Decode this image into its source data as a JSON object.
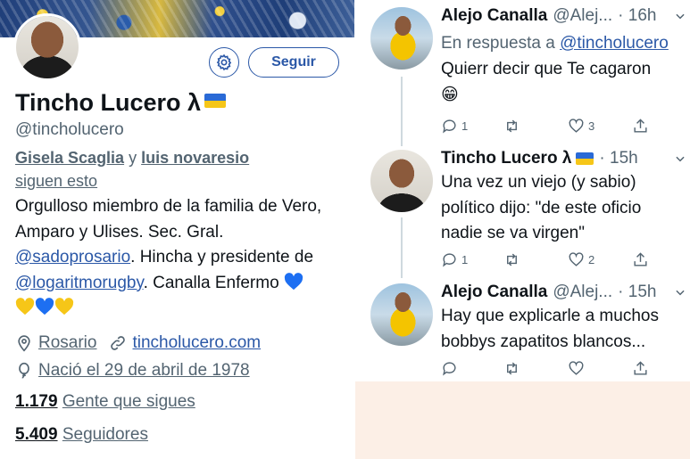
{
  "profile": {
    "name": "Tincho Lucero λ",
    "handle": "@tincholucero",
    "follow_label": "Seguir",
    "followed_by": {
      "user1": "Gisela Scaglia",
      "connector": "y",
      "user2": "luis novaresio",
      "suffix": "siguen esto"
    },
    "bio": {
      "part1": "Orgulloso miembro de la familia de Vero, Amparo y Ulises. Sec. Gral. ",
      "link1": "@sadoprosario",
      "part2": ". Hincha y presidente de ",
      "link2": "@logaritmorugby",
      "part3": ". Canalla Enfermo "
    },
    "location": "Rosario",
    "website": "tincholucero.com",
    "birth": "Nació el 29 de abril de 1978",
    "following_count": "1.179",
    "following_label": "Gente que sigues",
    "followers_count": "5.409",
    "followers_label": "Seguidores"
  },
  "colors": {
    "accent": "#2b58a7",
    "muted": "#536471",
    "heart_blue": "#1d6ff2",
    "heart_yellow": "#f6c618"
  },
  "tweets": [
    {
      "name": "Alejo Canalla",
      "handle": "@Alej...",
      "time": "· 16h",
      "reply_prefix": "En respuesta a",
      "reply_to": "@tincholucero",
      "text": "Quierr decir que Te cagaron",
      "emoji": "😁",
      "replies": "1",
      "likes": "3"
    },
    {
      "name": "Tincho Lucero λ",
      "handle": "",
      "time": "· 15h",
      "text": "Una vez un viejo (y sabio) político dijo: \"de este oficio nadie se va virgen\"",
      "replies": "1",
      "likes": "2"
    },
    {
      "name": "Alejo Canalla",
      "handle": "@Alej...",
      "time": "· 15h",
      "text": "Hay que explicarle a muchos bobbys zapatitos blancos...",
      "replies": "",
      "likes": ""
    }
  ]
}
